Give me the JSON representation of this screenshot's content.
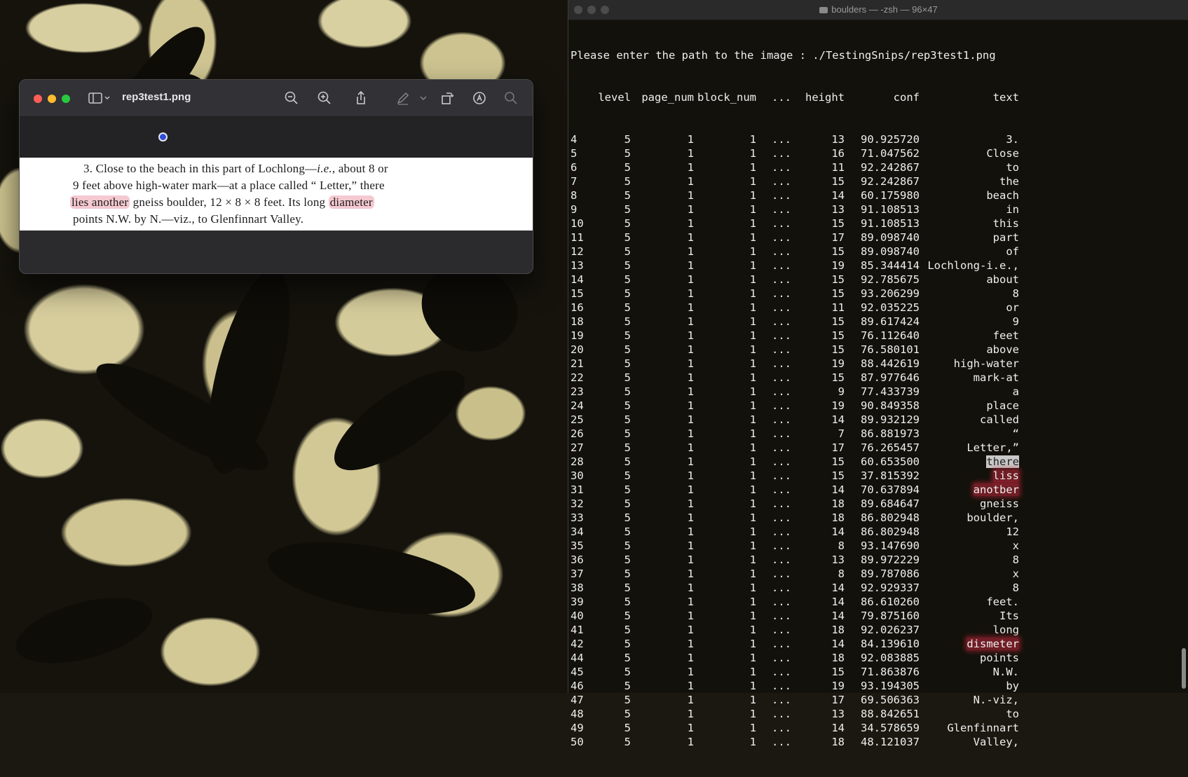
{
  "preview": {
    "title": "rep3test1.png",
    "document_lines": [
      [
        "3. Close to the beach in this part of Lochlong—",
        "i.e.",
        ", about 8 or"
      ],
      [
        "9 feet above high-water mark—at a place called “ Letter,” there"
      ],
      [
        "lies another",
        " gneiss boulder, 12 × 8 × 8 feet.  Its long ",
        "diameter"
      ],
      [
        "points N.W. by N.—viz., to Glenfinnart Valley."
      ]
    ]
  },
  "terminal": {
    "title": "boulders — -zsh — 96×47",
    "prompt": "Please enter the path to the image : ./TestingSnips/rep3test1.png",
    "headers": {
      "level": "level",
      "page_num": "page_num",
      "block_num": "block_num",
      "ellipsis": "...",
      "height": "height",
      "conf": "conf",
      "text": "text"
    },
    "rows": [
      {
        "idx": "4",
        "level": "5",
        "page": "1",
        "block": "1",
        "dots": "...",
        "height": "13",
        "conf": "90.925720",
        "text": "3."
      },
      {
        "idx": "5",
        "level": "5",
        "page": "1",
        "block": "1",
        "dots": "...",
        "height": "16",
        "conf": "71.047562",
        "text": "Close"
      },
      {
        "idx": "6",
        "level": "5",
        "page": "1",
        "block": "1",
        "dots": "...",
        "height": "11",
        "conf": "92.242867",
        "text": "to"
      },
      {
        "idx": "7",
        "level": "5",
        "page": "1",
        "block": "1",
        "dots": "...",
        "height": "15",
        "conf": "92.242867",
        "text": "the"
      },
      {
        "idx": "8",
        "level": "5",
        "page": "1",
        "block": "1",
        "dots": "...",
        "height": "14",
        "conf": "60.175980",
        "text": "beach"
      },
      {
        "idx": "9",
        "level": "5",
        "page": "1",
        "block": "1",
        "dots": "...",
        "height": "13",
        "conf": "91.108513",
        "text": "in"
      },
      {
        "idx": "10",
        "level": "5",
        "page": "1",
        "block": "1",
        "dots": "...",
        "height": "15",
        "conf": "91.108513",
        "text": "this"
      },
      {
        "idx": "11",
        "level": "5",
        "page": "1",
        "block": "1",
        "dots": "...",
        "height": "17",
        "conf": "89.098740",
        "text": "part"
      },
      {
        "idx": "12",
        "level": "5",
        "page": "1",
        "block": "1",
        "dots": "...",
        "height": "15",
        "conf": "89.098740",
        "text": "of"
      },
      {
        "idx": "13",
        "level": "5",
        "page": "1",
        "block": "1",
        "dots": "...",
        "height": "19",
        "conf": "85.344414",
        "text": "Lochlong-i.e.,"
      },
      {
        "idx": "14",
        "level": "5",
        "page": "1",
        "block": "1",
        "dots": "...",
        "height": "15",
        "conf": "92.785675",
        "text": "about"
      },
      {
        "idx": "15",
        "level": "5",
        "page": "1",
        "block": "1",
        "dots": "...",
        "height": "15",
        "conf": "93.206299",
        "text": "8"
      },
      {
        "idx": "16",
        "level": "5",
        "page": "1",
        "block": "1",
        "dots": "...",
        "height": "11",
        "conf": "92.035225",
        "text": "or"
      },
      {
        "idx": "18",
        "level": "5",
        "page": "1",
        "block": "1",
        "dots": "...",
        "height": "15",
        "conf": "89.617424",
        "text": "9"
      },
      {
        "idx": "19",
        "level": "5",
        "page": "1",
        "block": "1",
        "dots": "...",
        "height": "15",
        "conf": "76.112640",
        "text": "feet"
      },
      {
        "idx": "20",
        "level": "5",
        "page": "1",
        "block": "1",
        "dots": "...",
        "height": "15",
        "conf": "76.580101",
        "text": "above"
      },
      {
        "idx": "21",
        "level": "5",
        "page": "1",
        "block": "1",
        "dots": "...",
        "height": "19",
        "conf": "88.442619",
        "text": "high-water"
      },
      {
        "idx": "22",
        "level": "5",
        "page": "1",
        "block": "1",
        "dots": "...",
        "height": "15",
        "conf": "87.977646",
        "text": "mark-at"
      },
      {
        "idx": "23",
        "level": "5",
        "page": "1",
        "block": "1",
        "dots": "...",
        "height": "9",
        "conf": "77.433739",
        "text": "a"
      },
      {
        "idx": "24",
        "level": "5",
        "page": "1",
        "block": "1",
        "dots": "...",
        "height": "19",
        "conf": "90.849358",
        "text": "place"
      },
      {
        "idx": "25",
        "level": "5",
        "page": "1",
        "block": "1",
        "dots": "...",
        "height": "14",
        "conf": "89.932129",
        "text": "called"
      },
      {
        "idx": "26",
        "level": "5",
        "page": "1",
        "block": "1",
        "dots": "...",
        "height": "7",
        "conf": "86.881973",
        "text": "“"
      },
      {
        "idx": "27",
        "level": "5",
        "page": "1",
        "block": "1",
        "dots": "...",
        "height": "17",
        "conf": "76.265457",
        "text": "Letter,”"
      },
      {
        "idx": "28",
        "level": "5",
        "page": "1",
        "block": "1",
        "dots": "...",
        "height": "15",
        "conf": "60.653500",
        "text": "there",
        "mark": "select"
      },
      {
        "idx": "30",
        "level": "5",
        "page": "1",
        "block": "1",
        "dots": "...",
        "height": "15",
        "conf": "37.815392",
        "text": "liss",
        "mark": "highlight"
      },
      {
        "idx": "31",
        "level": "5",
        "page": "1",
        "block": "1",
        "dots": "...",
        "height": "14",
        "conf": "70.637894",
        "text": "anotber",
        "mark": "highlight"
      },
      {
        "idx": "32",
        "level": "5",
        "page": "1",
        "block": "1",
        "dots": "...",
        "height": "18",
        "conf": "89.684647",
        "text": "gneiss"
      },
      {
        "idx": "33",
        "level": "5",
        "page": "1",
        "block": "1",
        "dots": "...",
        "height": "18",
        "conf": "86.802948",
        "text": "boulder,"
      },
      {
        "idx": "34",
        "level": "5",
        "page": "1",
        "block": "1",
        "dots": "...",
        "height": "14",
        "conf": "86.802948",
        "text": "12"
      },
      {
        "idx": "35",
        "level": "5",
        "page": "1",
        "block": "1",
        "dots": "...",
        "height": "8",
        "conf": "93.147690",
        "text": "x"
      },
      {
        "idx": "36",
        "level": "5",
        "page": "1",
        "block": "1",
        "dots": "...",
        "height": "13",
        "conf": "89.972229",
        "text": "8"
      },
      {
        "idx": "37",
        "level": "5",
        "page": "1",
        "block": "1",
        "dots": "...",
        "height": "8",
        "conf": "89.787086",
        "text": "x"
      },
      {
        "idx": "38",
        "level": "5",
        "page": "1",
        "block": "1",
        "dots": "...",
        "height": "14",
        "conf": "92.929337",
        "text": "8"
      },
      {
        "idx": "39",
        "level": "5",
        "page": "1",
        "block": "1",
        "dots": "...",
        "height": "14",
        "conf": "86.610260",
        "text": "feet."
      },
      {
        "idx": "40",
        "level": "5",
        "page": "1",
        "block": "1",
        "dots": "...",
        "height": "14",
        "conf": "79.875160",
        "text": "Its"
      },
      {
        "idx": "41",
        "level": "5",
        "page": "1",
        "block": "1",
        "dots": "...",
        "height": "18",
        "conf": "92.026237",
        "text": "long"
      },
      {
        "idx": "42",
        "level": "5",
        "page": "1",
        "block": "1",
        "dots": "...",
        "height": "14",
        "conf": "84.139610",
        "text": "dismeter",
        "mark": "highlight"
      },
      {
        "idx": "44",
        "level": "5",
        "page": "1",
        "block": "1",
        "dots": "...",
        "height": "18",
        "conf": "92.083885",
        "text": "points"
      },
      {
        "idx": "45",
        "level": "5",
        "page": "1",
        "block": "1",
        "dots": "...",
        "height": "15",
        "conf": "71.863876",
        "text": "N.W."
      },
      {
        "idx": "46",
        "level": "5",
        "page": "1",
        "block": "1",
        "dots": "...",
        "height": "19",
        "conf": "93.194305",
        "text": "by"
      },
      {
        "idx": "47",
        "level": "5",
        "page": "1",
        "block": "1",
        "dots": "...",
        "height": "17",
        "conf": "69.506363",
        "text": "N.-viz,"
      },
      {
        "idx": "48",
        "level": "5",
        "page": "1",
        "block": "1",
        "dots": "...",
        "height": "13",
        "conf": "88.842651",
        "text": "to"
      },
      {
        "idx": "49",
        "level": "5",
        "page": "1",
        "block": "1",
        "dots": "...",
        "height": "14",
        "conf": "34.578659",
        "text": "Glenfinnart"
      },
      {
        "idx": "50",
        "level": "5",
        "page": "1",
        "block": "1",
        "dots": "...",
        "height": "18",
        "conf": "48.121037",
        "text": "Valley,"
      }
    ]
  },
  "colors": {
    "highlight": "#be283c",
    "terminal_bg": "#12110c",
    "preview_bg": "#2b2a2d"
  },
  "icons": [
    "sidebar-icon",
    "zoom-out-icon",
    "zoom-in-icon",
    "share-icon",
    "markup-pen-icon",
    "rotate-icon",
    "annotate-icon",
    "search-icon"
  ]
}
